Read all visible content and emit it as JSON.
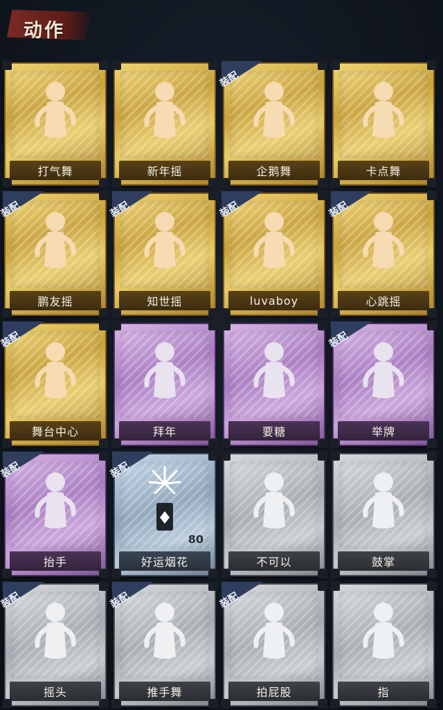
{
  "header": {
    "title": "动作"
  },
  "equip_badge_text": "装配",
  "cards": [
    {
      "label": "打气舞",
      "tier": "gold",
      "equipped": false,
      "icon": "dance-figure-icon"
    },
    {
      "label": "新年摇",
      "tier": "gold",
      "equipped": false,
      "icon": "dance-figure-icon"
    },
    {
      "label": "企鹅舞",
      "tier": "gold",
      "equipped": true,
      "icon": "dance-figure-icon"
    },
    {
      "label": "卡点舞",
      "tier": "gold",
      "equipped": false,
      "icon": "dance-figure-icon"
    },
    {
      "label": "鹏友摇",
      "tier": "gold",
      "equipped": true,
      "icon": "dance-figure-icon"
    },
    {
      "label": "知世摇",
      "tier": "gold",
      "equipped": true,
      "icon": "dance-figure-icon"
    },
    {
      "label": "luvaboy",
      "tier": "gold",
      "equipped": true,
      "icon": "dance-figure-icon"
    },
    {
      "label": "心跳摇",
      "tier": "gold",
      "equipped": true,
      "icon": "dance-figure-icon"
    },
    {
      "label": "舞台中心",
      "tier": "gold",
      "equipped": true,
      "icon": "dance-figure-icon"
    },
    {
      "label": "拜年",
      "tier": "purple",
      "equipped": false,
      "icon": "bow-figure-icon"
    },
    {
      "label": "要糖",
      "tier": "purple",
      "equipped": false,
      "icon": "reach-figure-icon"
    },
    {
      "label": "举牌",
      "tier": "purple",
      "equipped": true,
      "icon": "sign-figure-icon"
    },
    {
      "label": "抬手",
      "tier": "purple",
      "equipped": true,
      "icon": "wave-figure-icon"
    },
    {
      "label": "好运烟花",
      "tier": "blue",
      "equipped": true,
      "icon": "firework-icon",
      "count": "80"
    },
    {
      "label": "不可以",
      "tier": "gray",
      "equipped": false,
      "icon": "finger-wag-icon"
    },
    {
      "label": "鼓掌",
      "tier": "gray",
      "equipped": false,
      "icon": "clap-icon"
    },
    {
      "label": "摇头",
      "tier": "gray",
      "equipped": true,
      "icon": "head-shake-icon"
    },
    {
      "label": "推手舞",
      "tier": "gray",
      "equipped": true,
      "icon": "push-dance-icon"
    },
    {
      "label": "拍屁股",
      "tier": "gray",
      "equipped": true,
      "icon": "slap-icon"
    },
    {
      "label": "指",
      "tier": "gray",
      "equipped": false,
      "icon": "point-icon"
    }
  ]
}
